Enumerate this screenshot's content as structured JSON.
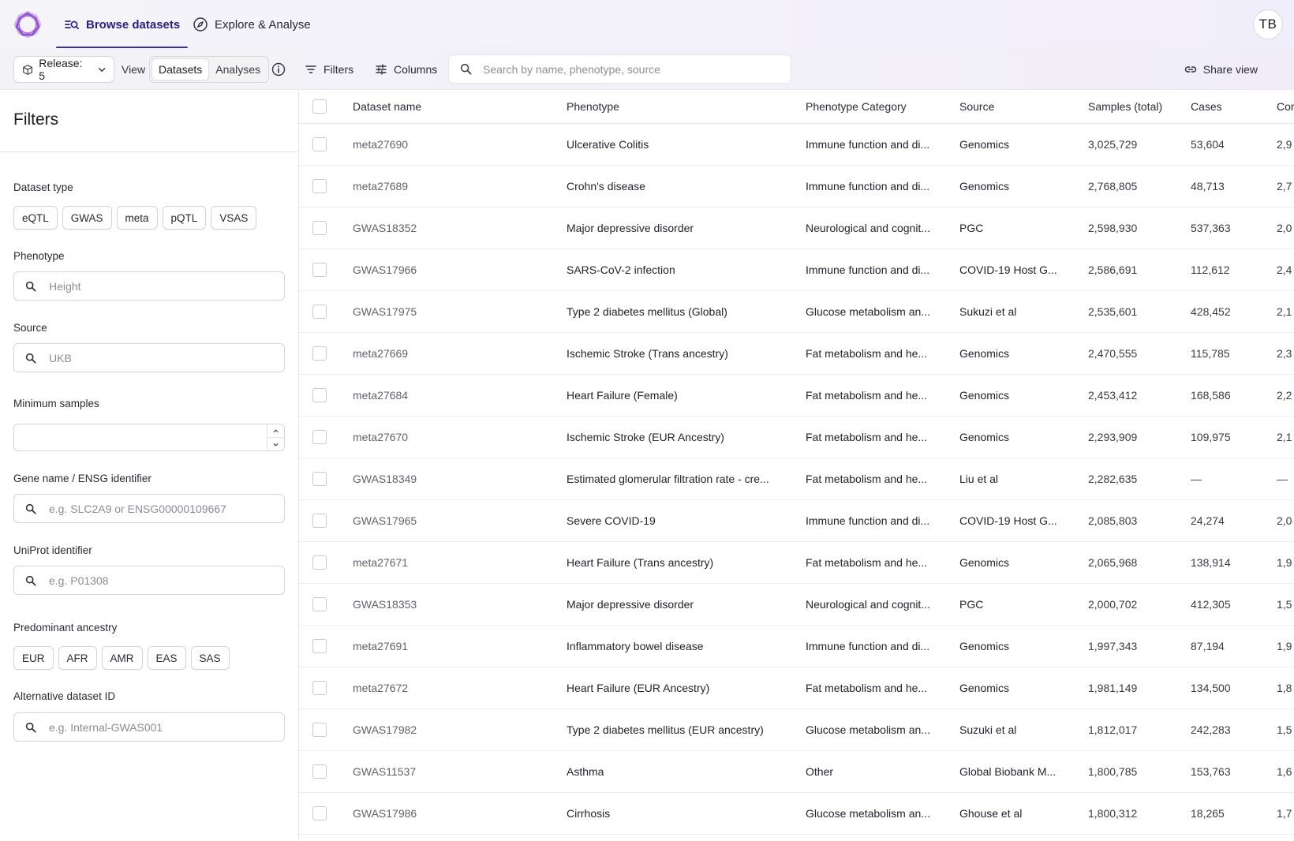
{
  "nav": {
    "tabs": [
      {
        "label": "Browse datasets",
        "icon": "dataset-search-icon"
      },
      {
        "label": "Explore & Analyse",
        "icon": "compass-icon"
      }
    ],
    "avatar_initials": "TB"
  },
  "toolbar": {
    "release_label": "Release: 5",
    "view_label": "View",
    "view_options": [
      "Datasets",
      "Analyses"
    ],
    "filters_label": "Filters",
    "columns_label": "Columns",
    "search_placeholder": "Search by name, phenotype, source",
    "share_label": "Share view"
  },
  "filters": {
    "title": "Filters",
    "dataset_type": {
      "label": "Dataset type",
      "options": [
        "eQTL",
        "GWAS",
        "meta",
        "pQTL",
        "VSAS"
      ]
    },
    "phenotype": {
      "label": "Phenotype",
      "placeholder": "Height"
    },
    "source": {
      "label": "Source",
      "placeholder": "UKB"
    },
    "minimum_samples": {
      "label": "Minimum samples"
    },
    "gene": {
      "label": "Gene name / ENSG identifier",
      "placeholder": "e.g. SLC2A9 or ENSG00000109667"
    },
    "uniprot": {
      "label": "UniProt identifier",
      "placeholder": "e.g. P01308"
    },
    "ancestry": {
      "label": "Predominant ancestry",
      "options": [
        "EUR",
        "AFR",
        "AMR",
        "EAS",
        "SAS"
      ]
    },
    "alt_id": {
      "label": "Alternative dataset ID",
      "placeholder": "e.g. Internal-GWAS001"
    }
  },
  "table": {
    "columns": [
      "Dataset name",
      "Phenotype",
      "Phenotype Category",
      "Source",
      "Samples (total)",
      "Cases",
      "Cor"
    ],
    "rows": [
      [
        "meta27690",
        "Ulcerative Colitis",
        "Immune function and di...",
        "Genomics",
        "3,025,729",
        "53,604",
        "2,9"
      ],
      [
        "meta27689",
        "Crohn's disease",
        "Immune function and di...",
        "Genomics",
        "2,768,805",
        "48,713",
        "2,7"
      ],
      [
        "GWAS18352",
        "Major depressive disorder",
        "Neurological and cognit...",
        "PGC",
        "2,598,930",
        "537,363",
        "2,0"
      ],
      [
        "GWAS17966",
        "SARS-CoV-2 infection",
        "Immune function and di...",
        "COVID-19 Host G...",
        "2,586,691",
        "112,612",
        "2,4"
      ],
      [
        "GWAS17975",
        "Type 2 diabetes mellitus (Global)",
        "Glucose metabolism an...",
        "Sukuzi et al",
        "2,535,601",
        "428,452",
        "2,1"
      ],
      [
        "meta27669",
        "Ischemic Stroke (Trans ancestry)",
        "Fat metabolism and he...",
        "Genomics",
        "2,470,555",
        "115,785",
        "2,3"
      ],
      [
        "meta27684",
        "Heart Failure (Female)",
        "Fat metabolism and he...",
        "Genomics",
        "2,453,412",
        "168,586",
        "2,2"
      ],
      [
        "meta27670",
        "Ischemic Stroke (EUR Ancestry)",
        "Fat metabolism and he...",
        "Genomics",
        "2,293,909",
        "109,975",
        "2,1"
      ],
      [
        "GWAS18349",
        "Estimated glomerular filtration rate - cre...",
        "Fat metabolism and he...",
        "Liu et al",
        "2,282,635",
        "—",
        "—"
      ],
      [
        "GWAS17965",
        "Severe COVID-19",
        "Immune function and di...",
        "COVID-19 Host G...",
        "2,085,803",
        "24,274",
        "2,0"
      ],
      [
        "meta27671",
        "Heart Failure (Trans ancestry)",
        "Fat metabolism and he...",
        "Genomics",
        "2,065,968",
        "138,914",
        "1,9"
      ],
      [
        "GWAS18353",
        "Major depressive disorder",
        "Neurological and cognit...",
        "PGC",
        "2,000,702",
        "412,305",
        "1,5"
      ],
      [
        "meta27691",
        "Inflammatory bowel disease",
        "Immune function and di...",
        "Genomics",
        "1,997,343",
        "87,194",
        "1,9"
      ],
      [
        "meta27672",
        "Heart Failure (EUR Ancestry)",
        "Fat metabolism and he...",
        "Genomics",
        "1,981,149",
        "134,500",
        "1,8"
      ],
      [
        "GWAS17982",
        "Type 2 diabetes mellitus (EUR ancestry)",
        "Glucose metabolism an...",
        "Suzuki et al",
        "1,812,017",
        "242,283",
        "1,5"
      ],
      [
        "GWAS11537",
        "Asthma",
        "Other",
        "Global Biobank M...",
        "1,800,785",
        "153,763",
        "1,6"
      ],
      [
        "GWAS17986",
        "Cirrhosis",
        "Glucose metabolism an...",
        "Ghouse et al",
        "1,800,312",
        "18,265",
        "1,7"
      ]
    ]
  },
  "colors": {
    "accent": "#3a2f9e",
    "logo_ring": "#8c5cd6"
  }
}
